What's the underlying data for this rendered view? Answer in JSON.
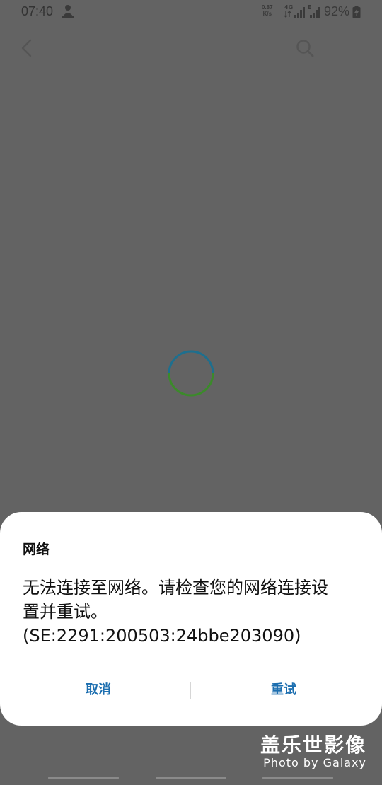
{
  "status_bar": {
    "time": "07:40",
    "speed_value": "0.87",
    "speed_unit": "K/s",
    "network_type": "4G",
    "network_e": "E",
    "battery": "92%"
  },
  "dialog": {
    "title": "网络",
    "message": "无法连接至网络。请检查您的网络连接设\n置并重试。\n(SE:2291:200503:24bbe203090)",
    "cancel_label": "取消",
    "retry_label": "重试"
  },
  "watermark": {
    "line1": "盖乐世影像",
    "line2": "Photo by Galaxy"
  },
  "colors": {
    "accent": "#1d6fb0",
    "spinner_blue": "#1e6f8e",
    "spinner_green": "#3b8a2a"
  }
}
